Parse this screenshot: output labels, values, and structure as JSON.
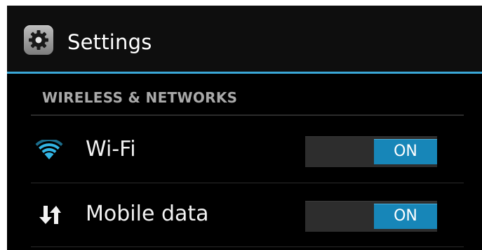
{
  "action_bar": {
    "title": "Settings",
    "icon": "gear-icon"
  },
  "section": {
    "header": "WIRELESS & NETWORKS"
  },
  "items": [
    {
      "label": "Wi-Fi",
      "icon": "wifi-icon",
      "toggle": "ON"
    },
    {
      "label": "Mobile data",
      "icon": "mobile-data-icon",
      "toggle": "ON"
    }
  ],
  "colors": {
    "accent": "#33b5e5",
    "toggle_on": "#1786b8",
    "background": "#000000"
  }
}
